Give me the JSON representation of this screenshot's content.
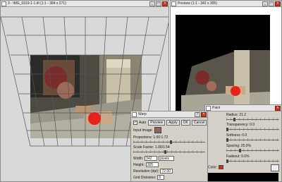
{
  "colors": {
    "accent_red": "#e8211b",
    "window_gray": "#d4d0c8"
  },
  "left_window": {
    "title": "3 - IMG_0319-1-1.tif (1:1 - 384 x 271)",
    "icon": "image-icon"
  },
  "preview_window": {
    "title": "Preview (1:1 - 342 x 305)",
    "icon": "image-icon"
  },
  "warp": {
    "title": "Warp",
    "auto_label": "Auto",
    "auto_checked": true,
    "buttons": {
      "preview": "Preview",
      "apply": "Apply",
      "ok": "OK",
      "cancel": "Cancel"
    },
    "input_image_label": "Input Image:",
    "proportions_label": "Proportions: 1.00:1.72",
    "proportions_value": 0.5,
    "scale_label": "Scale Factor: 1.00/1.54",
    "scale_value": 0.42,
    "width_label": "Width:",
    "width_value": "342",
    "width_unit": "pixels",
    "height_label": "Height:",
    "height_value": "305",
    "resolution_label": "Resolution (dpi):",
    "resolution_value": "72.00",
    "grid_label": "Grid Divisions:",
    "grid_value": "8"
  },
  "paint": {
    "title": "Paint",
    "radius_label": "Radius: 21.2",
    "radius_value": 0.2,
    "transparency_label": "Transparency: 0.0",
    "transparency_value": 0.0,
    "softness_label": "Softness: 0.0",
    "softness_value": 0.0,
    "spacing_label": "Spacing: 25.0%",
    "spacing_value": 0.25,
    "fadeout_label": "Fadeout: 0.0%",
    "fadeout_value": 0.0,
    "color_label": "Color:"
  }
}
